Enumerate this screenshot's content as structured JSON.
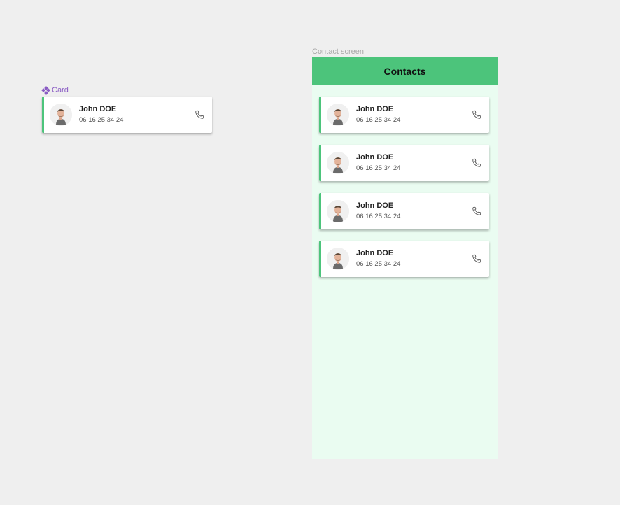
{
  "component": {
    "label": "Card"
  },
  "frame": {
    "label": "Contact screen",
    "title": "Contacts"
  },
  "component_card": {
    "name": "John DOE",
    "phone": "06 16 25 34 24"
  },
  "contacts": [
    {
      "name": "John DOE",
      "phone": "06 16 25 34 24"
    },
    {
      "name": "John DOE",
      "phone": "06 16 25 34 24"
    },
    {
      "name": "John DOE",
      "phone": "06 16 25 34 24"
    },
    {
      "name": "John DOE",
      "phone": "06 16 25 34 24"
    }
  ],
  "icons": {
    "component": "component-icon",
    "avatar": "avatar-photo",
    "call": "phone-icon"
  },
  "colors": {
    "accent": "#4cc47b",
    "screen_bg": "#eafcf1",
    "canvas_bg": "#efefef",
    "component_label": "#8a5cc4"
  }
}
